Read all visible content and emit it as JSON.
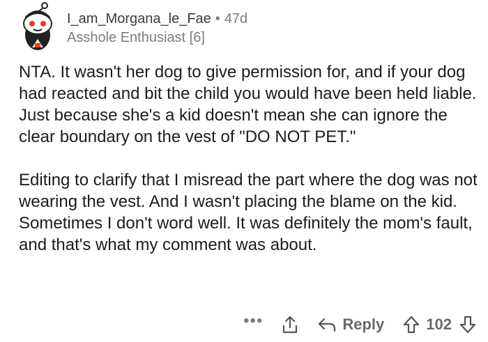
{
  "comment": {
    "author": "I_am_Morgana_le_Fae",
    "separator": "•",
    "age": "47d",
    "flair": "Asshole Enthusiast [6]",
    "paragraphs": [
      "NTA. It wasn't her dog to give permission for, and if your dog had reacted and bit the child you would have been held liable. Just because she's a kid doesn't mean she can ignore the clear boundary on the vest of \"DO NOT PET.\"",
      "Editing to clarify that I misread the part where the dog was not wearing the vest. And I wasn't placing the blame on the kid. Sometimes I don't word well. It was definitely the mom's fault, and that's what my comment was about."
    ]
  },
  "actions": {
    "more": "•••",
    "reply_label": "Reply",
    "score": "102"
  },
  "icons": {
    "avatar": "avatar-icon",
    "more": "more-options-icon",
    "share": "share-icon",
    "reply": "reply-arrow-icon",
    "upvote": "upvote-icon",
    "downvote": "downvote-icon"
  },
  "colors": {
    "text": "#1c1c1c",
    "meta": "#7c7c7c",
    "icon": "#555555",
    "avatar_eyes": "#e23b2e"
  }
}
